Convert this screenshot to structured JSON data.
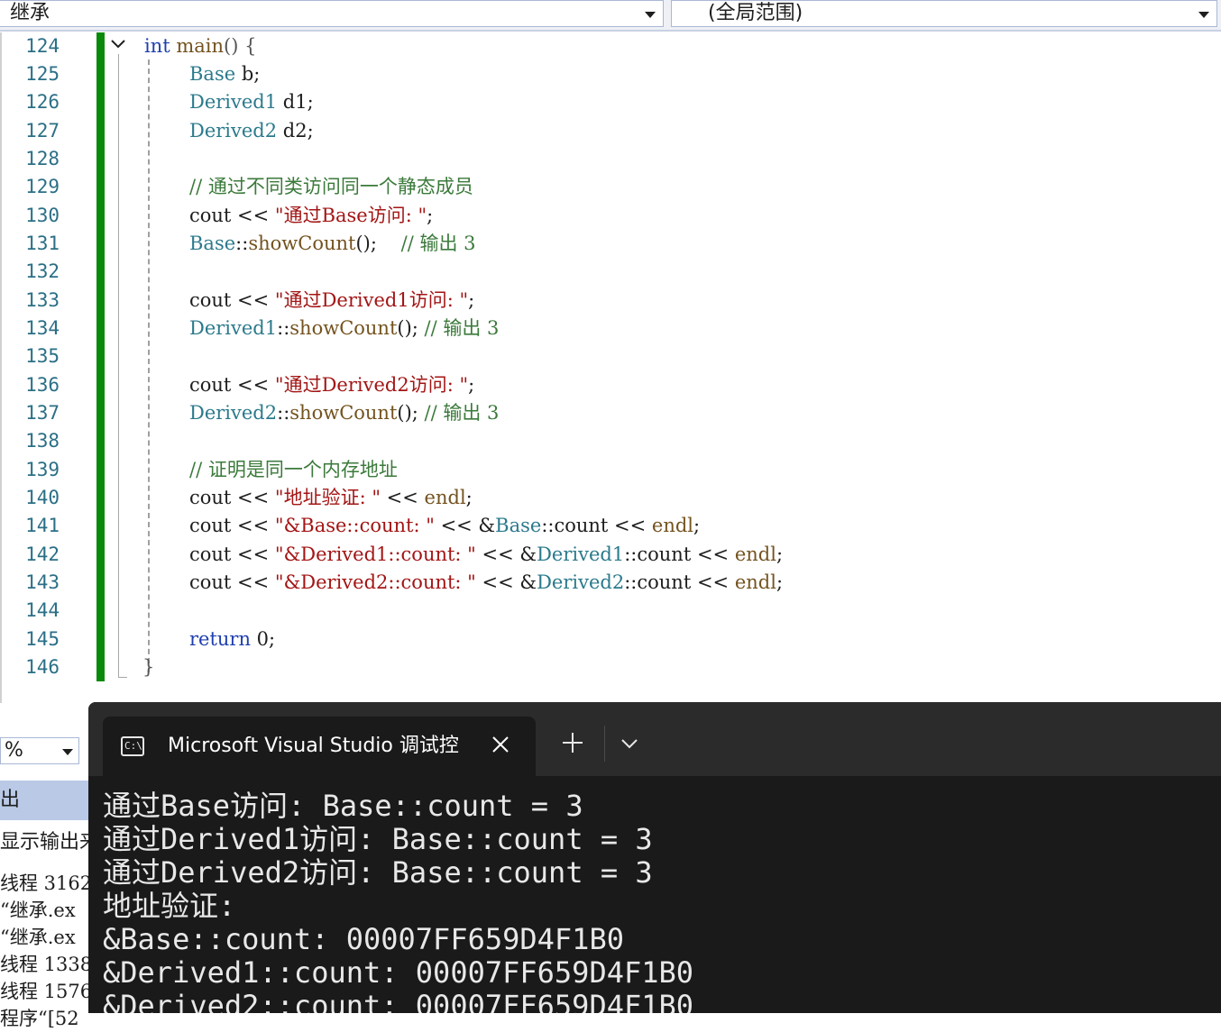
{
  "toolbar": {
    "scope_left": "继承",
    "scope_right": "(全局范围)"
  },
  "editor": {
    "line_numbers": [
      "124",
      "125",
      "126",
      "127",
      "128",
      "129",
      "130",
      "131",
      "132",
      "133",
      "134",
      "135",
      "136",
      "137",
      "138",
      "139",
      "140",
      "141",
      "142",
      "143",
      "144",
      "145",
      "146"
    ],
    "code": {
      "l124": {
        "kw": "int",
        "name": " main",
        "rest": "() {"
      },
      "l125": {
        "type": "Base",
        "rest": " b;"
      },
      "l126": {
        "type": "Derived1",
        "rest": " d1;"
      },
      "l127": {
        "type": "Derived2",
        "rest": " d2;"
      },
      "l129": {
        "comment": "// 通过不同类访问同一个静态成员"
      },
      "l130": {
        "pre": "cout << ",
        "str": "\"通过Base访问: \"",
        "post": ";"
      },
      "l131": {
        "type": "Base",
        "mid": "::",
        "fn": "showCount",
        "rest": "();    ",
        "comment": "// 输出 3"
      },
      "l133": {
        "pre": "cout << ",
        "str": "\"通过Derived1访问: \"",
        "post": ";"
      },
      "l134": {
        "type": "Derived1",
        "mid": "::",
        "fn": "showCount",
        "rest": "(); ",
        "comment": "// 输出 3"
      },
      "l136": {
        "pre": "cout << ",
        "str": "\"通过Derived2访问: \"",
        "post": ";"
      },
      "l137": {
        "type": "Derived2",
        "mid": "::",
        "fn": "showCount",
        "rest": "(); ",
        "comment": "// 输出 3"
      },
      "l139": {
        "comment": "// 证明是同一个内存地址"
      },
      "l140": {
        "pre": "cout << ",
        "str": "\"地址验证: \"",
        "mid": " << ",
        "fn": "endl",
        "post": ";"
      },
      "l141": {
        "pre": "cout << ",
        "str": "\"&Base::count: \"",
        "mid": " << &",
        "type": "Base",
        "mid2": "::count << ",
        "fn": "endl",
        "post": ";"
      },
      "l142": {
        "pre": "cout << ",
        "str": "\"&Derived1::count: \"",
        "mid": " << &",
        "type": "Derived1",
        "mid2": "::count << ",
        "fn": "endl",
        "post": ";"
      },
      "l143": {
        "pre": "cout << ",
        "str": "\"&Derived2::count: \"",
        "mid": " << &",
        "type": "Derived2",
        "mid2": "::count << ",
        "fn": "endl",
        "post": ";"
      },
      "l145": {
        "kw": "return",
        "rest": " 0;"
      },
      "l146": {
        "rest": "}"
      }
    }
  },
  "output_panel": {
    "zoom": "%",
    "header": "出",
    "show_output_label": "显示输出来",
    "rows": [
      "线程 3162",
      "“继承.ex",
      "“继承.ex",
      "线程 1338",
      "线程 1576",
      "程序“[52"
    ]
  },
  "terminal": {
    "tab_title": "Microsoft Visual Studio 调试控",
    "icon_text": "C:\\",
    "lines": [
      "通过Base访问: Base::count = 3",
      "通过Derived1访问: Base::count = 3",
      "通过Derived2访问: Base::count = 3",
      "地址验证:",
      "&Base::count: 00007FF659D4F1B0",
      "&Derived1::count: 00007FF659D4F1B0",
      "&Derived2::count: 00007FF659D4F1B0"
    ]
  }
}
